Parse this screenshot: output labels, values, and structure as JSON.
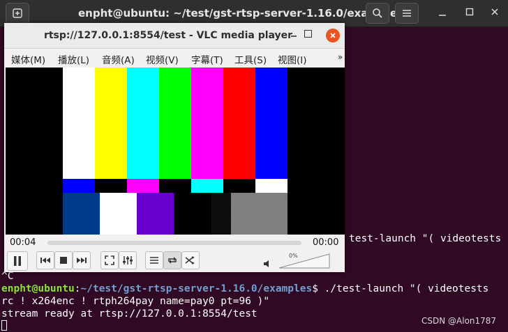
{
  "terminal": {
    "title": "enpht@ubuntu: ~/test/gst-rtsp-server-1.16.0/examples",
    "line_launch_tail": "test-launch \"( videotests",
    "line_ctrl_c": "^C",
    "prompt_user": "enpht@ubuntu",
    "prompt_sep": ":",
    "prompt_path": "~/test/gst-rtsp-server-1.16.0/examples",
    "command": "$ ./test-launch \"( videotests",
    "command_cont": "rc ! x264enc ! rtph264pay name=pay0 pt=96 )\"",
    "stream_ready": "stream ready at rtsp://127.0.0.1:8554/test"
  },
  "watermark": "CSDN @Alon1787",
  "vlc": {
    "title": "rtsp://127.0.0.1:8554/test - VLC media player",
    "menu": [
      "媒体(M)",
      "播放(L)",
      "音频(A)",
      "视频(V)",
      "字幕(T)",
      "工具(S)",
      "视图(I)"
    ],
    "menu_overflow": "»",
    "time_elapsed": "00:04",
    "time_total": "00:00",
    "volume": "0%",
    "icons": [
      "pause-icon",
      "previous-icon",
      "stop-icon",
      "next-icon",
      "fullscreen-icon",
      "extended-settings-icon",
      "playlist-icon",
      "loop-icon",
      "shuffle-icon",
      "volume-muted-icon"
    ]
  },
  "colors": {
    "terminal_bg": "#300a24",
    "prompt_user": "#8ae234",
    "prompt_path": "#729fcf",
    "close_button": "#e95420"
  }
}
